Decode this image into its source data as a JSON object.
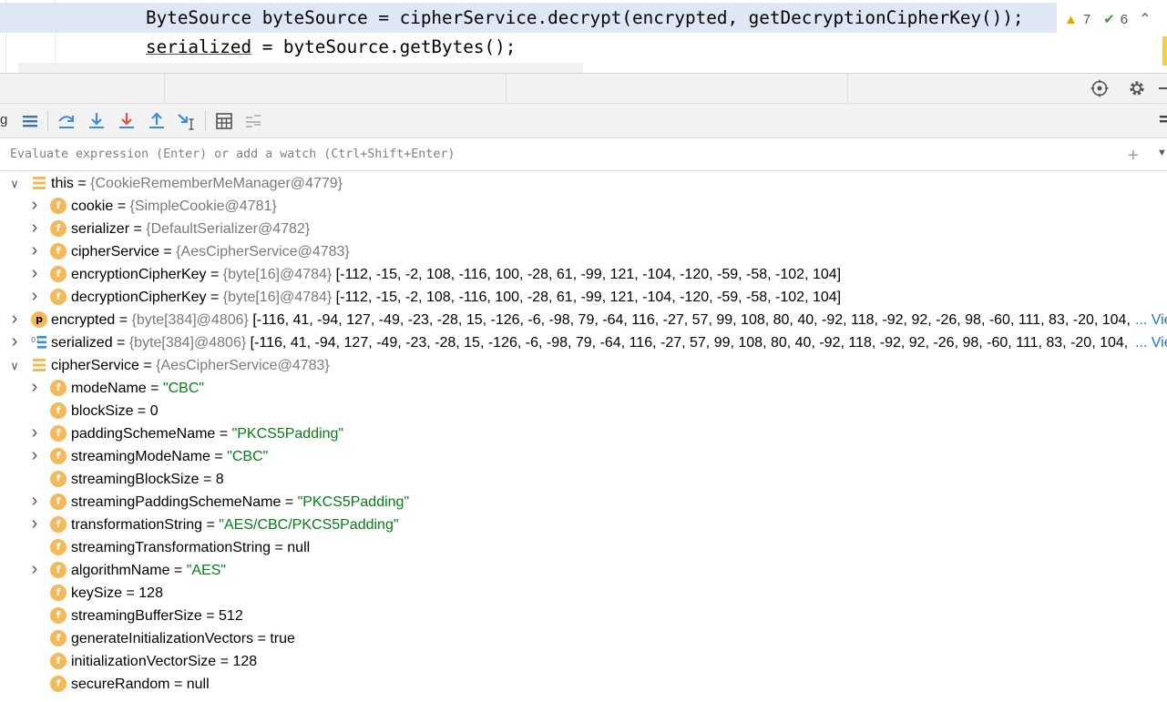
{
  "editor": {
    "line1": "ByteSource byteSource = cipherService.decrypt(encrypted, getDecryptionCipherKey());",
    "line2_var": "serialized",
    "line2_rest": " = byteSource.getBytes();",
    "inspections": {
      "warnings": "7",
      "ok": "6"
    }
  },
  "toolbar": {
    "left_text": "g"
  },
  "evaluate": {
    "placeholder": "Evaluate expression (Enter) or add a watch (Ctrl+Shift+Enter)"
  },
  "tree": [
    {
      "depth": 0,
      "expanded": true,
      "badge": "this",
      "name": "this",
      "type": "{CookieRememberMeManager@4779}",
      "value": ""
    },
    {
      "depth": 1,
      "expandable": true,
      "badge": "f",
      "name": "cookie",
      "type": "{SimpleCookie@4781}",
      "value": ""
    },
    {
      "depth": 1,
      "expandable": true,
      "badge": "f",
      "name": "serializer",
      "type": "{DefaultSerializer@4782}",
      "value": ""
    },
    {
      "depth": 1,
      "expandable": true,
      "badge": "f",
      "name": "cipherService",
      "type": "{AesCipherService@4783}",
      "value": ""
    },
    {
      "depth": 1,
      "expandable": true,
      "badge": "f",
      "name": "encryptionCipherKey",
      "type": "{byte[16]@4784}",
      "value": "[-112, -15, -2, 108, -116, 100, -28, 61, -99, 121, -104, -120, -59, -58, -102, 104]"
    },
    {
      "depth": 1,
      "expandable": true,
      "badge": "f",
      "name": "decryptionCipherKey",
      "type": "{byte[16]@4784}",
      "value": "[-112, -15, -2, 108, -116, 100, -28, 61, -99, 121, -104, -120, -59, -58, -102, 104]"
    },
    {
      "depth": 0,
      "expandable": true,
      "badge": "p",
      "name": "encrypted",
      "type": "{byte[384]@4806}",
      "value": "[-116, 41, -94, 127, -49, -23, -28, 15, -126, -6, -98, 79, -64, 116, -27, 57, 99, 108, 80, 40, -92, 118, -92, 92, -26, 98, -60, 111, 83, -20, 104,",
      "link": "... Vie"
    },
    {
      "depth": 0,
      "expandable": true,
      "badge": "local",
      "name": "serialized",
      "type": "{byte[384]@4806}",
      "value": "[-116, 41, -94, 127, -49, -23, -28, 15, -126, -6, -98, 79, -64, 116, -27, 57, 99, 108, 80, 40, -92, 118, -92, 92, -26, 98, -60, 111, 83, -20, 104, ",
      "link": "... Vie"
    },
    {
      "depth": 0,
      "expanded": true,
      "badge": "this",
      "name": "cipherService",
      "type": "{AesCipherService@4783}",
      "value": ""
    },
    {
      "depth": 1,
      "expandable": true,
      "badge": "f",
      "name": "modeName",
      "str": "\"CBC\""
    },
    {
      "depth": 1,
      "expandable": false,
      "badge": "f",
      "name": "blockSize",
      "num": "0"
    },
    {
      "depth": 1,
      "expandable": true,
      "badge": "f",
      "name": "paddingSchemeName",
      "str": "\"PKCS5Padding\""
    },
    {
      "depth": 1,
      "expandable": true,
      "badge": "f",
      "name": "streamingModeName",
      "str": "\"CBC\""
    },
    {
      "depth": 1,
      "expandable": false,
      "badge": "f",
      "name": "streamingBlockSize",
      "num": "8"
    },
    {
      "depth": 1,
      "expandable": true,
      "badge": "f",
      "name": "streamingPaddingSchemeName",
      "str": "\"PKCS5Padding\""
    },
    {
      "depth": 1,
      "expandable": true,
      "badge": "f",
      "name": "transformationString",
      "str": "\"AES/CBC/PKCS5Padding\""
    },
    {
      "depth": 1,
      "expandable": false,
      "badge": "f",
      "name": "streamingTransformationString",
      "num": "null"
    },
    {
      "depth": 1,
      "expandable": true,
      "badge": "f",
      "name": "algorithmName",
      "str": "\"AES\""
    },
    {
      "depth": 1,
      "expandable": false,
      "badge": "f",
      "name": "keySize",
      "num": "128"
    },
    {
      "depth": 1,
      "expandable": false,
      "badge": "f",
      "name": "streamingBufferSize",
      "num": "512"
    },
    {
      "depth": 1,
      "expandable": false,
      "badge": "f",
      "name": "generateInitializationVectors",
      "num": "true"
    },
    {
      "depth": 1,
      "expandable": false,
      "badge": "f",
      "name": "initializationVectorSize",
      "num": "128"
    },
    {
      "depth": 1,
      "expandable": false,
      "badge": "f",
      "name": "secureRandom",
      "num": "null"
    }
  ],
  "colors": {
    "string": "#067d17",
    "type": "#7a7a7a",
    "link": "#2470d4",
    "badge": "#f5b95a",
    "highlight": "#dfe7f7"
  }
}
